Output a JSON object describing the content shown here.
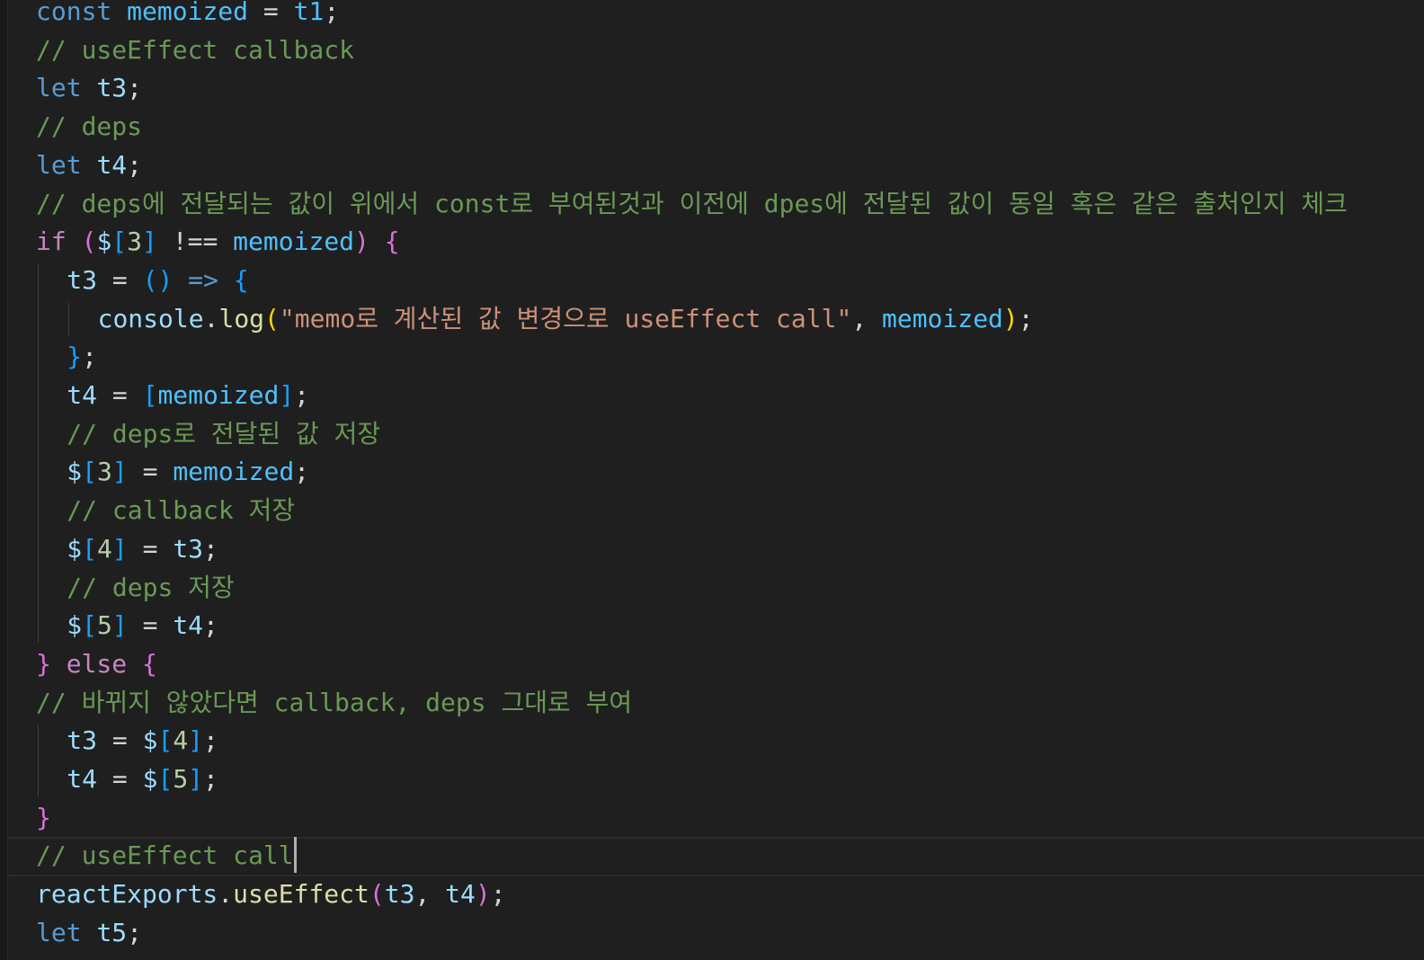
{
  "editor": {
    "lines": [
      {
        "indent": 0,
        "tokens": [
          {
            "t": "const",
            "c": "kw"
          },
          {
            "t": " "
          },
          {
            "t": "memoized",
            "c": "cst"
          },
          {
            "t": " = "
          },
          {
            "t": "t1",
            "c": "cst"
          },
          {
            "t": ";"
          }
        ]
      },
      {
        "indent": 0,
        "tokens": [
          {
            "t": "// useEffect callback",
            "c": "cmt"
          }
        ]
      },
      {
        "indent": 0,
        "tokens": [
          {
            "t": "let",
            "c": "kw"
          },
          {
            "t": " "
          },
          {
            "t": "t3",
            "c": "var"
          },
          {
            "t": ";"
          }
        ]
      },
      {
        "indent": 0,
        "tokens": [
          {
            "t": "// deps",
            "c": "cmt"
          }
        ]
      },
      {
        "indent": 0,
        "tokens": [
          {
            "t": "let",
            "c": "kw"
          },
          {
            "t": " "
          },
          {
            "t": "t4",
            "c": "var"
          },
          {
            "t": ";"
          }
        ]
      },
      {
        "indent": 0,
        "tokens": [
          {
            "t": "// deps에 전달되는 값이 위에서 const로 부여된것과 이전에 dpes에 전달된 값이 동일 혹은 같은 출처인지 체크",
            "c": "cmt"
          }
        ]
      },
      {
        "indent": 0,
        "tokens": [
          {
            "t": "if",
            "c": "ctl"
          },
          {
            "t": " "
          },
          {
            "t": "(",
            "c": "b2"
          },
          {
            "t": "$",
            "c": "var"
          },
          {
            "t": "[",
            "c": "b3"
          },
          {
            "t": "3",
            "c": "num"
          },
          {
            "t": "]",
            "c": "b3"
          },
          {
            "t": " !== "
          },
          {
            "t": "memoized",
            "c": "cst"
          },
          {
            "t": ")",
            "c": "b2"
          },
          {
            "t": " "
          },
          {
            "t": "{",
            "c": "b2"
          }
        ]
      },
      {
        "indent": 1,
        "tokens": [
          {
            "t": "t3",
            "c": "var"
          },
          {
            "t": " = "
          },
          {
            "t": "()",
            "c": "b3"
          },
          {
            "t": " "
          },
          {
            "t": "=>",
            "c": "kw"
          },
          {
            "t": " "
          },
          {
            "t": "{",
            "c": "b3"
          }
        ]
      },
      {
        "indent": 2,
        "tokens": [
          {
            "t": "console",
            "c": "var"
          },
          {
            "t": "."
          },
          {
            "t": "log",
            "c": "fn"
          },
          {
            "t": "(",
            "c": "b1"
          },
          {
            "t": "\"memo로 계산된 값 변경으로 useEffect call\"",
            "c": "str"
          },
          {
            "t": ", "
          },
          {
            "t": "memoized",
            "c": "cst"
          },
          {
            "t": ")",
            "c": "b1"
          },
          {
            "t": ";"
          }
        ]
      },
      {
        "indent": 1,
        "tokens": [
          {
            "t": "}",
            "c": "b3"
          },
          {
            "t": ";"
          }
        ]
      },
      {
        "indent": 1,
        "tokens": [
          {
            "t": "t4",
            "c": "var"
          },
          {
            "t": " = "
          },
          {
            "t": "[",
            "c": "b3"
          },
          {
            "t": "memoized",
            "c": "cst"
          },
          {
            "t": "]",
            "c": "b3"
          },
          {
            "t": ";"
          }
        ]
      },
      {
        "indent": 1,
        "tokens": [
          {
            "t": "// deps로 전달된 값 저장",
            "c": "cmt"
          }
        ]
      },
      {
        "indent": 1,
        "tokens": [
          {
            "t": "$",
            "c": "var"
          },
          {
            "t": "[",
            "c": "b3"
          },
          {
            "t": "3",
            "c": "num"
          },
          {
            "t": "]",
            "c": "b3"
          },
          {
            "t": " = "
          },
          {
            "t": "memoized",
            "c": "cst"
          },
          {
            "t": ";"
          }
        ]
      },
      {
        "indent": 1,
        "tokens": [
          {
            "t": "// callback 저장",
            "c": "cmt"
          }
        ]
      },
      {
        "indent": 1,
        "tokens": [
          {
            "t": "$",
            "c": "var"
          },
          {
            "t": "[",
            "c": "b3"
          },
          {
            "t": "4",
            "c": "num"
          },
          {
            "t": "]",
            "c": "b3"
          },
          {
            "t": " = "
          },
          {
            "t": "t3",
            "c": "var"
          },
          {
            "t": ";"
          }
        ]
      },
      {
        "indent": 1,
        "tokens": [
          {
            "t": "// deps 저장",
            "c": "cmt"
          }
        ]
      },
      {
        "indent": 1,
        "tokens": [
          {
            "t": "$",
            "c": "var"
          },
          {
            "t": "[",
            "c": "b3"
          },
          {
            "t": "5",
            "c": "num"
          },
          {
            "t": "]",
            "c": "b3"
          },
          {
            "t": " = "
          },
          {
            "t": "t4",
            "c": "var"
          },
          {
            "t": ";"
          }
        ]
      },
      {
        "indent": 0,
        "tokens": [
          {
            "t": "}",
            "c": "b2"
          },
          {
            "t": " "
          },
          {
            "t": "else",
            "c": "ctl"
          },
          {
            "t": " "
          },
          {
            "t": "{",
            "c": "b2"
          }
        ]
      },
      {
        "indent": 0,
        "tokens": [
          {
            "t": "// 바뀌지 않았다면 callback, deps 그대로 부여",
            "c": "cmt"
          }
        ]
      },
      {
        "indent": 1,
        "tokens": [
          {
            "t": "t3",
            "c": "var"
          },
          {
            "t": " = "
          },
          {
            "t": "$",
            "c": "var"
          },
          {
            "t": "[",
            "c": "b3"
          },
          {
            "t": "4",
            "c": "num"
          },
          {
            "t": "]",
            "c": "b3"
          },
          {
            "t": ";"
          }
        ]
      },
      {
        "indent": 1,
        "tokens": [
          {
            "t": "t4",
            "c": "var"
          },
          {
            "t": " = "
          },
          {
            "t": "$",
            "c": "var"
          },
          {
            "t": "[",
            "c": "b3"
          },
          {
            "t": "5",
            "c": "num"
          },
          {
            "t": "]",
            "c": "b3"
          },
          {
            "t": ";"
          }
        ]
      },
      {
        "indent": 0,
        "tokens": [
          {
            "t": "}",
            "c": "b2"
          }
        ]
      },
      {
        "indent": 0,
        "current": true,
        "cursor": true,
        "tokens": [
          {
            "t": "// useEffect call",
            "c": "cmt"
          }
        ]
      },
      {
        "indent": 0,
        "tokens": [
          {
            "t": "reactExports",
            "c": "var"
          },
          {
            "t": "."
          },
          {
            "t": "useEffect",
            "c": "fn"
          },
          {
            "t": "(",
            "c": "b2"
          },
          {
            "t": "t3",
            "c": "var"
          },
          {
            "t": ", "
          },
          {
            "t": "t4",
            "c": "var"
          },
          {
            "t": ")",
            "c": "b2"
          },
          {
            "t": ";"
          }
        ]
      },
      {
        "indent": 0,
        "tokens": [
          {
            "t": "let",
            "c": "kw"
          },
          {
            "t": " "
          },
          {
            "t": "t5",
            "c": "var"
          },
          {
            "t": ";"
          }
        ]
      }
    ],
    "colors": {
      "background": "#1f1f1f",
      "keyword": "#569cd6",
      "control": "#c586c0",
      "variable": "#9cdcfe",
      "constant": "#4fc1ff",
      "function": "#dcdcaa",
      "string": "#ce9178",
      "comment": "#6a9955",
      "number": "#b5cea8"
    }
  }
}
